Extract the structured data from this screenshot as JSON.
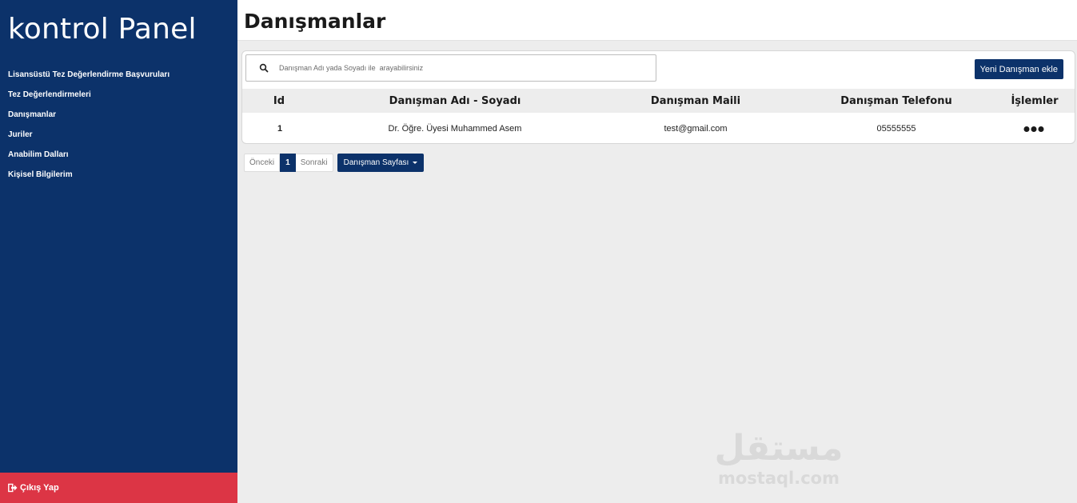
{
  "sidebar": {
    "brand": "kontrol Panel",
    "items": [
      {
        "label": "Lisansüstü Tez Değerlendirme Başvuruları"
      },
      {
        "label": "Tez Değerlendirmeleri"
      },
      {
        "label": "Danışmanlar"
      },
      {
        "label": "Juriler"
      },
      {
        "label": "Anabilim Dalları"
      },
      {
        "label": "Kişisel Bilgilerim"
      }
    ],
    "logout_label": "Çıkış Yap"
  },
  "header": {
    "title": "Danışmanlar"
  },
  "search": {
    "placeholder": "Danışman Adı yada Soyadı ile  arayabilirsiniz",
    "value": ""
  },
  "toolbar": {
    "add_label": "Yeni Danışman ekle"
  },
  "table": {
    "headers": [
      "Id",
      "Danışman Adı - Soyadı",
      "Danışman Maili",
      "Danışman Telefonu",
      "İşlemler"
    ],
    "rows": [
      {
        "id": "1",
        "name": "Dr. Öğre. Üyesi Muhammed Asem",
        "email": "test@gmail.com",
        "phone": "05555555"
      }
    ]
  },
  "pagination": {
    "prev_label": "Önceki",
    "current_page": "1",
    "next_label": "Sonraki",
    "page_menu_label": "Danışman Sayfası"
  },
  "watermark": {
    "arabic": "مستقل",
    "latin": "mostaql.com"
  },
  "colors": {
    "sidebar_bg": "#0c326a",
    "accent": "#0c326a",
    "logout_bg": "#dc3545",
    "page_bg": "#ededed"
  },
  "icons": {
    "search": "search-icon",
    "logout": "sign-out-icon",
    "actions": "more-dots-icon"
  }
}
